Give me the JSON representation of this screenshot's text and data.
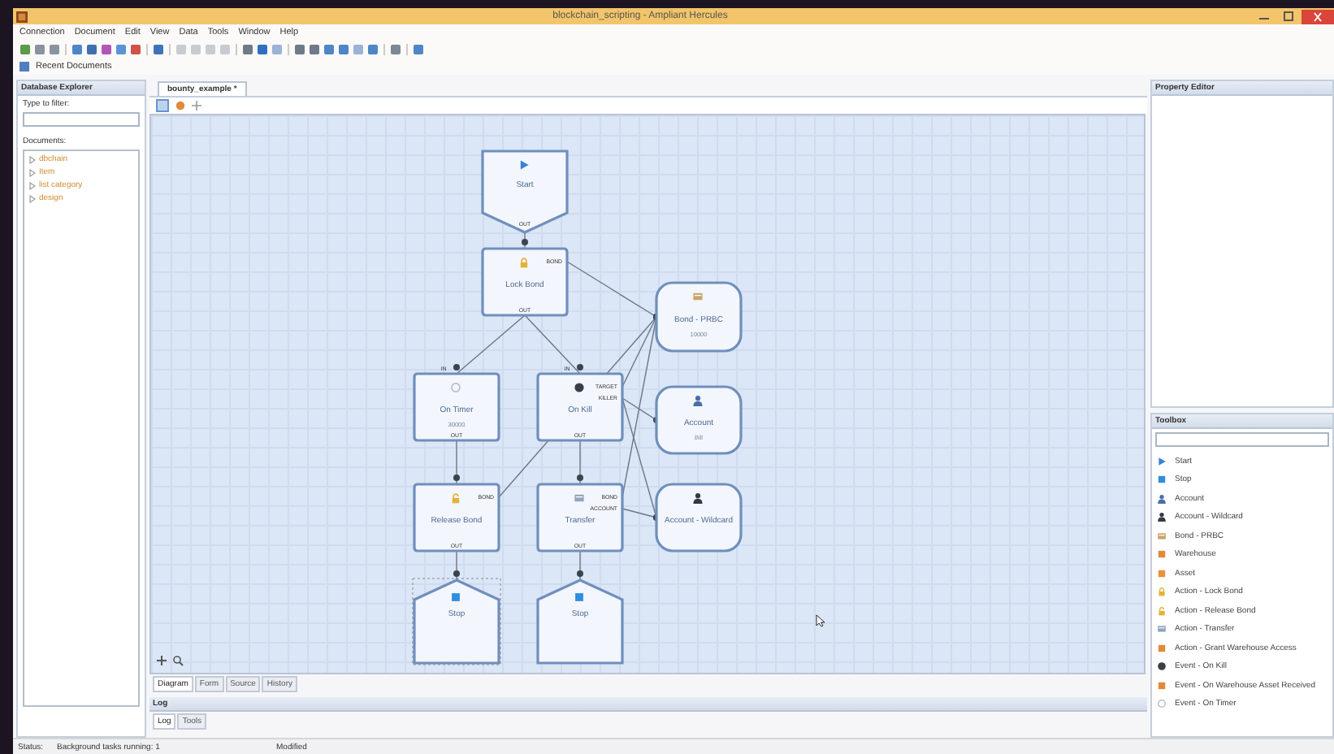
{
  "window": {
    "title": "blockchain_scripting - Ampliant Hercules"
  },
  "menu": [
    "Connection",
    "Document",
    "Edit",
    "View",
    "Data",
    "Tools",
    "Window",
    "Help"
  ],
  "recent_documents": "Recent Documents",
  "database_explorer": {
    "title": "Database Explorer",
    "filter_label": "Type to filter:",
    "documents_label": "Documents:",
    "tree": [
      {
        "label": "dbchain"
      },
      {
        "label": "Item"
      },
      {
        "label": "list category"
      },
      {
        "label": "design"
      }
    ]
  },
  "editor": {
    "tabs": [
      {
        "label": "bounty_example *",
        "selected": true
      }
    ],
    "nodes": [
      {
        "kind": "start",
        "label": "Start",
        "selected": false,
        "output": "OUT"
      },
      {
        "kind": "action-lock",
        "label": "Lock Bond",
        "selected": false,
        "right_ports": [
          "BOND"
        ],
        "output": "OUT"
      },
      {
        "kind": "bond",
        "label": "Bond - PRBC",
        "sub": "10000",
        "selected": false
      },
      {
        "kind": "event-timer",
        "label": "On Timer",
        "sub": "30000",
        "selected": false,
        "input": "IN",
        "output": "OUT"
      },
      {
        "kind": "event-kill",
        "label": "On Kill",
        "selected": false,
        "input": "IN",
        "right_ports": [
          "TARGET",
          "KILLER"
        ],
        "output": "OUT"
      },
      {
        "kind": "account",
        "label": "Account",
        "sub": "Bill",
        "selected": false
      },
      {
        "kind": "action-release",
        "label": "Release Bond",
        "selected": false,
        "right_ports": [
          "BOND"
        ],
        "output": "OUT"
      },
      {
        "kind": "action-transfer",
        "label": "Transfer",
        "selected": false,
        "right_ports": [
          "BOND",
          "ACCOUNT"
        ],
        "output": "OUT"
      },
      {
        "kind": "account-wildcard",
        "label": "Account - Wildcard",
        "selected": false
      },
      {
        "kind": "stop",
        "label": "Stop",
        "selected": true
      },
      {
        "kind": "stop",
        "label": "Stop",
        "selected": false
      }
    ],
    "view_tabs": [
      {
        "label": "Diagram",
        "selected": true
      },
      {
        "label": "Form",
        "selected": false
      },
      {
        "label": "Source",
        "selected": false
      },
      {
        "label": "History",
        "selected": false
      }
    ]
  },
  "property_editor": {
    "title": "Property Editor"
  },
  "toolbox": {
    "title": "Toolbox",
    "items": [
      {
        "kind": "start",
        "label": "Start"
      },
      {
        "kind": "stop",
        "label": "Stop"
      },
      {
        "kind": "account",
        "label": "Account"
      },
      {
        "kind": "account-wildcard",
        "label": "Account - Wildcard"
      },
      {
        "kind": "bond",
        "label": "Bond - PRBC"
      },
      {
        "kind": "warehouse",
        "label": "Warehouse"
      },
      {
        "kind": "asset",
        "label": "Asset"
      },
      {
        "kind": "action-lock",
        "label": "Action - Lock Bond"
      },
      {
        "kind": "action-release",
        "label": "Action - Release Bond"
      },
      {
        "kind": "action-transfer",
        "label": "Action - Transfer"
      },
      {
        "kind": "action-grant",
        "label": "Action - Grant Warehouse Access"
      },
      {
        "kind": "event-kill",
        "label": "Event - On Kill"
      },
      {
        "kind": "event-received",
        "label": "Event - On Warehouse Asset Received"
      },
      {
        "kind": "event-timer",
        "label": "Event - On Timer"
      }
    ]
  },
  "log": {
    "title": "Log",
    "tabs": [
      {
        "label": "Log",
        "selected": true
      },
      {
        "label": "Tools",
        "selected": false
      }
    ]
  },
  "status_bar": {
    "label": "Status:",
    "tasks": "Background tasks running: 1",
    "state": "Modified"
  }
}
